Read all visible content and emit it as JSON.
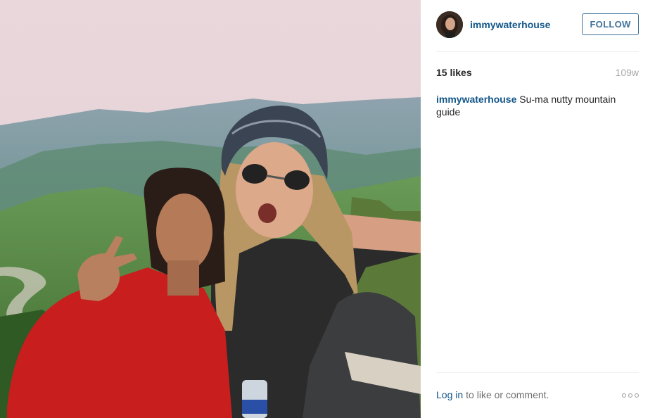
{
  "post": {
    "photo": {
      "icon": "post-photo"
    },
    "header": {
      "avatar_icon": "profile-avatar",
      "username": "immywaterhouse",
      "follow_label": "FOLLOW"
    },
    "stats": {
      "likes_text": "15 likes",
      "timestamp": "109w"
    },
    "caption": {
      "username": "immywaterhouse",
      "text": "Su-ma nutty mountain guide"
    },
    "footer": {
      "login_label": "Log in",
      "suffix_text": "to like or comment.",
      "more_icon": "ellipsis-icon"
    }
  },
  "colors": {
    "link": "#125688",
    "follow_border": "#3f729b",
    "muted": "#a5a7aa",
    "text": "#262626"
  }
}
